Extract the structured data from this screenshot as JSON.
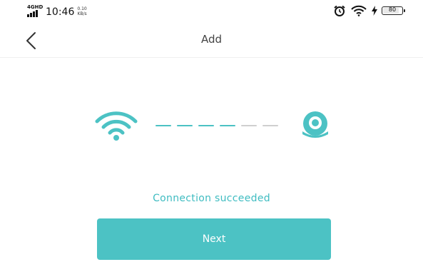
{
  "status_bar": {
    "network": "4G",
    "network_sub": "HD",
    "time": "10:46",
    "speed_value": "0.10",
    "speed_unit": "KB/s",
    "battery_level": "80",
    "icons": [
      "alarm-icon",
      "wifi-icon",
      "charging-icon",
      "battery-icon"
    ]
  },
  "header": {
    "back_icon": "chevron-left-icon",
    "title": "Add"
  },
  "progress": {
    "start_icon": "wifi-icon",
    "end_icon": "camera-icon",
    "steps_total": 6,
    "steps_completed": 4,
    "active_color": "#4cc2c4",
    "inactive_color": "#cfcfcf"
  },
  "main": {
    "status_text": "Connection succeeded",
    "next_label": "Next"
  },
  "colors": {
    "accent": "#4cc2c4",
    "status_text": "#3fbcc1",
    "background": "#ffffff"
  }
}
